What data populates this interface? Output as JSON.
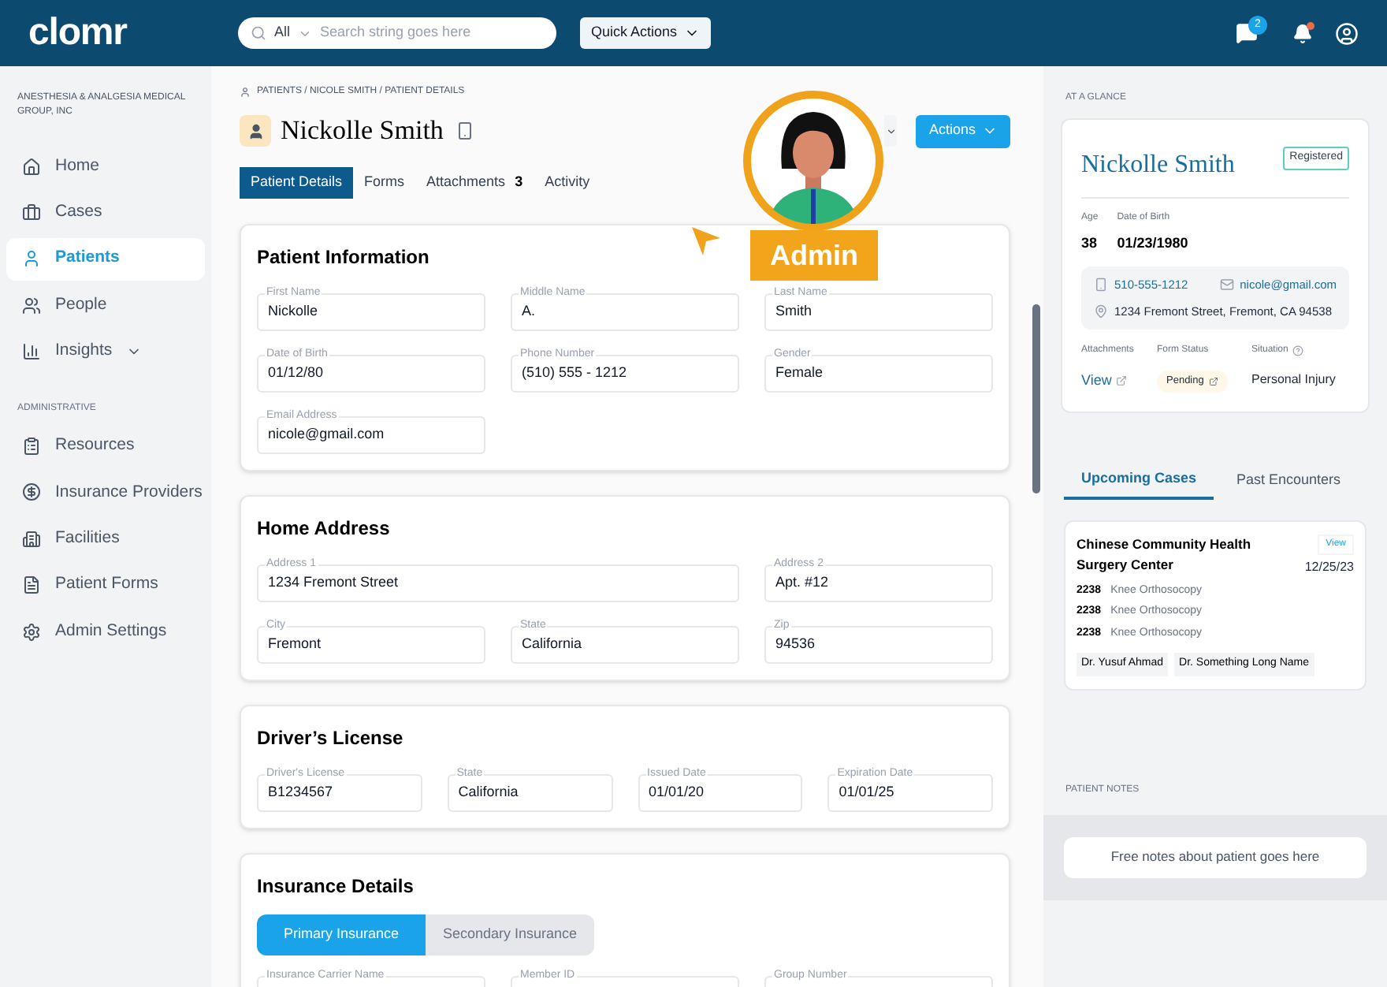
{
  "topbar": {
    "logo": "clomr",
    "search": {
      "scope": "All",
      "placeholder": "Search string goes here"
    },
    "quick_actions": "Quick Actions",
    "messages_badge": "2",
    "notifications_unread": true
  },
  "sidebar": {
    "org": "ANESTHESIA & ANALGESIA MEDICAL GROUP, INC",
    "main_items": [
      {
        "label": "Home",
        "selected": false,
        "has_submenu": false
      },
      {
        "label": "Cases",
        "selected": false,
        "has_submenu": false
      },
      {
        "label": "Patients",
        "selected": true,
        "has_submenu": false
      },
      {
        "label": "People",
        "selected": false,
        "has_submenu": false
      },
      {
        "label": "Insights",
        "selected": false,
        "has_submenu": true
      }
    ],
    "admin_title": "ADMINISTRATIVE",
    "admin_items": [
      {
        "label": "Resources",
        "selected": false,
        "has_submenu": false
      },
      {
        "label": "Insurance Providers",
        "selected": false,
        "has_submenu": false
      },
      {
        "label": "Facilities",
        "selected": false,
        "has_submenu": false
      },
      {
        "label": "Patient Forms",
        "selected": false,
        "has_submenu": false
      },
      {
        "label": "Admin Settings",
        "selected": false,
        "has_submenu": false
      }
    ]
  },
  "header": {
    "breadcrumb": "PATIENTS / NICOLE SMITH / PATIENT DETAILS",
    "name": "Nickolle Smith",
    "actions": "Actions",
    "tabs": [
      {
        "label": "Patient Details",
        "selected": true
      },
      {
        "label": "Forms",
        "selected": false
      },
      {
        "label": "Attachments",
        "count": "3",
        "selected": false
      },
      {
        "label": "Activity",
        "selected": false
      }
    ]
  },
  "sections": [
    {
      "title": "Patient Information",
      "rows": [
        {
          "fields": [
            {
              "label": "First Name",
              "value": "Nickolle"
            },
            {
              "label": "Middle Name",
              "value": "A."
            },
            {
              "label": "Last Name",
              "value": "Smith"
            }
          ]
        },
        {
          "fields": [
            {
              "label": "Date of Birth",
              "value": "01/12/80"
            },
            {
              "label": "Phone Number",
              "value": "(510)  555 - 1212"
            },
            {
              "label": "Gender",
              "value": "Female"
            }
          ]
        },
        {
          "fields": [
            {
              "label": "Email Address",
              "value": "nicole@gmail.com"
            }
          ]
        }
      ]
    },
    {
      "title": "Home Address",
      "rows": [
        {
          "fields": [
            {
              "label": "Address 1",
              "value": "1234 Fremont Street"
            },
            {
              "label": "Address 2",
              "value": "Apt. #12"
            }
          ]
        },
        {
          "fields": [
            {
              "label": "City",
              "value": "Fremont"
            },
            {
              "label": "State",
              "value": "California"
            },
            {
              "label": "Zip",
              "value": "94536"
            }
          ]
        }
      ]
    },
    {
      "title": "Driver’s License",
      "rows": [
        {
          "fields": [
            {
              "label": "Driver's License",
              "value": "B1234567"
            },
            {
              "label": "State",
              "value": "California"
            },
            {
              "label": "Issued Date",
              "value": "01/01/20"
            },
            {
              "label": "Expiration Date",
              "value": "01/01/25"
            }
          ]
        }
      ]
    },
    {
      "title": "Insurance Details",
      "subtabs": [
        {
          "label": "Primary Insurance",
          "selected": true
        },
        {
          "label": "Secondary Insurance",
          "selected": false
        }
      ],
      "rows": [
        {
          "fields": [
            {
              "label": "Insurance Carrier Name"
            },
            {
              "label": "Member ID"
            },
            {
              "label": "Group Number"
            }
          ]
        }
      ]
    }
  ],
  "overlay": {
    "role": "Admin"
  },
  "glance": {
    "title": "AT A GLANCE",
    "name": "Nickolle Smith",
    "status": "Registered",
    "age_label": "Age",
    "age": "38",
    "dob_label": "Date of Birth",
    "dob": "01/23/1980",
    "phone": "510-555-1212",
    "email": "nicole@gmail.com",
    "address": "1234 Fremont Street, Fremont, CA 94538",
    "attachments_label": "Attachments",
    "attachments_link": "View",
    "form_status_label": "Form Status",
    "form_status": "Pending",
    "situation_label": "Situation",
    "situation": "Personal Injury"
  },
  "case_tabs": [
    {
      "label": "Upcoming Cases",
      "selected": true
    },
    {
      "label": "Past Encounters",
      "selected": false
    }
  ],
  "case": {
    "facility": "Chinese Community Health Surgery Center",
    "view": "View",
    "date": "12/25/23",
    "procedures": [
      {
        "code": "2238",
        "name": "Knee Orthosocopy"
      },
      {
        "code": "2238",
        "name": "Knee Orthosocopy"
      },
      {
        "code": "2238",
        "name": "Knee Orthosocopy"
      }
    ],
    "doctors": [
      "Dr. Yusuf Ahmad",
      "Dr. Something Long Name"
    ]
  },
  "notes": {
    "title": "PATIENT NOTES",
    "placeholder": "Free notes about patient goes here"
  }
}
